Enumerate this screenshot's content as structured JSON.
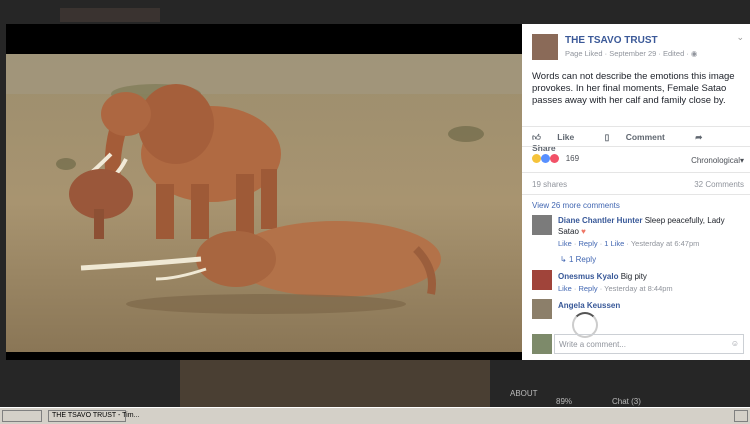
{
  "background": {
    "about_label": "ABOUT",
    "pct": "89%",
    "chat_label": "Chat (3)"
  },
  "post": {
    "page_name": "THE TSAVO TRUST",
    "meta": "Page Liked · September 29 · Edited · ",
    "text": "Words can not describe the emotions this image provokes. In her final moments, Female Satao passes away with her calf and family close by.",
    "actions": {
      "like": "Like",
      "comment": "Comment",
      "share": "Share"
    },
    "reaction_count": "169",
    "sort_label": "Chronological",
    "shares": "19 shares",
    "comments_count": "32 Comments",
    "view_more": "View 26 more comments",
    "write_placeholder": "Write a comment..."
  },
  "comments": [
    {
      "name": "Diane Chantler Hunter",
      "text": " Sleep peacefully, Lady Satao",
      "like": "Like",
      "reply": "Reply",
      "likes": "1 Like",
      "time": "Yesterday at 6:47pm",
      "replies": "1 Reply"
    },
    {
      "name": "Onesmus Kyalo",
      "text": " Big pity",
      "like": "Like",
      "reply": "Reply",
      "time": "Yesterday at 8:44pm"
    },
    {
      "name": "Angela Keussen",
      "text": ""
    }
  ],
  "taskbar": {
    "window_title": "THE TSAVO TRUST - Tim..."
  },
  "colors": {
    "link": "#3b5998",
    "panel": "#ffffff"
  }
}
